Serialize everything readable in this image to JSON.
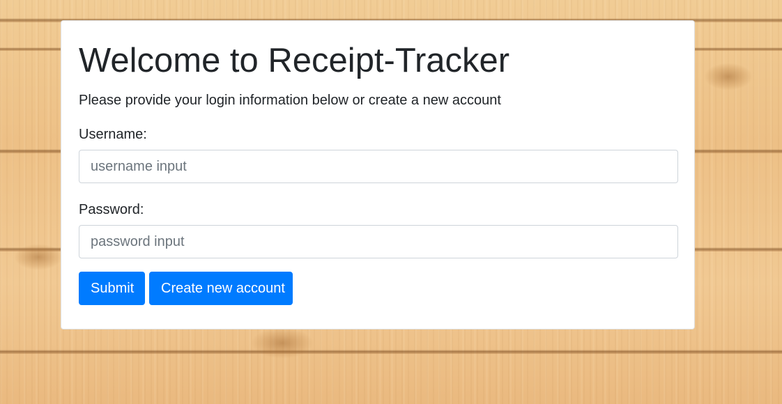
{
  "page": {
    "title": "Welcome to Receipt-Tracker",
    "subtitle": "Please provide your login information below or create a new account"
  },
  "form": {
    "username_label": "Username:",
    "username_placeholder": "username input",
    "username_value": "",
    "password_label": "Password:",
    "password_placeholder": "password input",
    "password_value": "",
    "submit_label": "Submit",
    "create_label": "Create new account"
  },
  "colors": {
    "primary_button": "#007bff",
    "card_background": "#ffffff",
    "text": "#212529",
    "background": "wood-planks"
  }
}
